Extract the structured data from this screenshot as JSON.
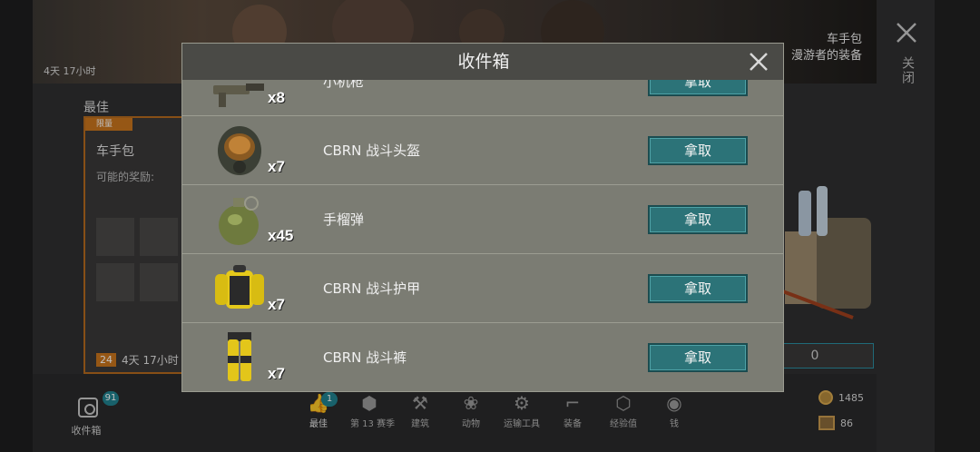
{
  "banner": {
    "timer": "4天 17小时",
    "title": "车手包",
    "subtitle": "漫游者的装备",
    "close_label": "关闭"
  },
  "offer": {
    "section_label": "最佳",
    "tag": "限量",
    "title": "车手包",
    "rewards_label": "可能的奖励:",
    "count": "24",
    "timer": "4天 17小时"
  },
  "price_box": "0",
  "inbox": {
    "label": "收件箱",
    "badge": "91"
  },
  "nav": {
    "items": [
      {
        "label": "最佳",
        "icon": "thumbs-up-icon",
        "badge": "1"
      },
      {
        "label": "第 13 赛季",
        "icon": "season-icon"
      },
      {
        "label": "建筑",
        "icon": "hammer-icon"
      },
      {
        "label": "动物",
        "icon": "paw-icon"
      },
      {
        "label": "运输工具",
        "icon": "motorcycle-icon"
      },
      {
        "label": "装备",
        "icon": "pistol-icon"
      },
      {
        "label": "经验值",
        "icon": "xp-icon"
      },
      {
        "label": "钱",
        "icon": "coin-icon"
      }
    ]
  },
  "currency": {
    "coins": "1485",
    "crates": "86"
  },
  "modal": {
    "title": "收件箱",
    "items": [
      {
        "name": "小机枪",
        "count": "x8",
        "action": "拿取",
        "icon": "smg-icon"
      },
      {
        "name": "CBRN 战斗头盔",
        "count": "x7",
        "action": "拿取",
        "icon": "gas-mask-helmet-icon"
      },
      {
        "name": "手榴弹",
        "count": "x45",
        "action": "拿取",
        "icon": "grenade-icon"
      },
      {
        "name": "CBRN 战斗护甲",
        "count": "x7",
        "action": "拿取",
        "icon": "hazmat-armor-icon"
      },
      {
        "name": "CBRN 战斗裤",
        "count": "x7",
        "action": "拿取",
        "icon": "hazmat-pants-icon"
      }
    ]
  },
  "colors": {
    "accent_teal": "#2c7378",
    "offer_orange": "#c8741c",
    "modal_bg": "#7b7c73"
  }
}
